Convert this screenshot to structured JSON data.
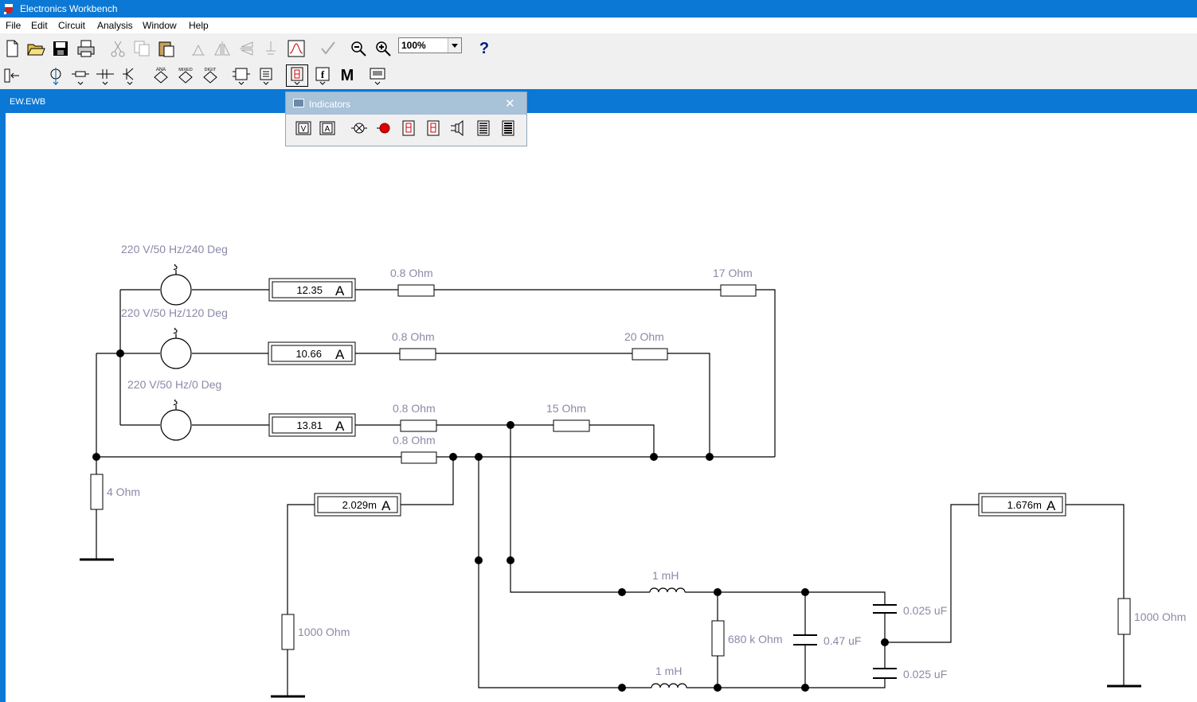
{
  "app": {
    "title": "Electronics Workbench"
  },
  "menu": [
    "File",
    "Edit",
    "Circuit",
    "Analysis",
    "Window",
    "Help"
  ],
  "toolbar": {
    "zoom": "100%",
    "help_label": "?",
    "meter_label": "M",
    "analog_label": "ANA",
    "mixed_label": "MIXED",
    "digital_label": "DIGIT"
  },
  "document": {
    "title": "EW.EWB"
  },
  "palette": {
    "title": "Indicators"
  },
  "circuit": {
    "sources": [
      "220 V/50 Hz/240 Deg",
      "220 V/50 Hz/120 Deg",
      "220 V/50 Hz/0 Deg"
    ],
    "ammeters": [
      "12.35",
      "10.66",
      "13.81",
      "2.029m",
      "1.676m"
    ],
    "ammeter_unit": "A",
    "resistors": [
      "0.8  Ohm",
      "17  Ohm",
      "0.8  Ohm",
      "20  Ohm",
      "0.8  Ohm",
      "15  Ohm",
      "0.8  Ohm",
      "4  Ohm",
      "1000  Ohm",
      "680 k Ohm",
      "1000  Ohm"
    ],
    "inductors": [
      "1 mH",
      "1 mH"
    ],
    "capacitors": [
      "0.47 uF",
      "0.025 uF",
      "0.025 uF"
    ]
  },
  "colors": {
    "titlebar": "#0a78d4",
    "label": "#8a8aa8",
    "wire": "#000000",
    "palette_title": "#a8c2d8"
  }
}
